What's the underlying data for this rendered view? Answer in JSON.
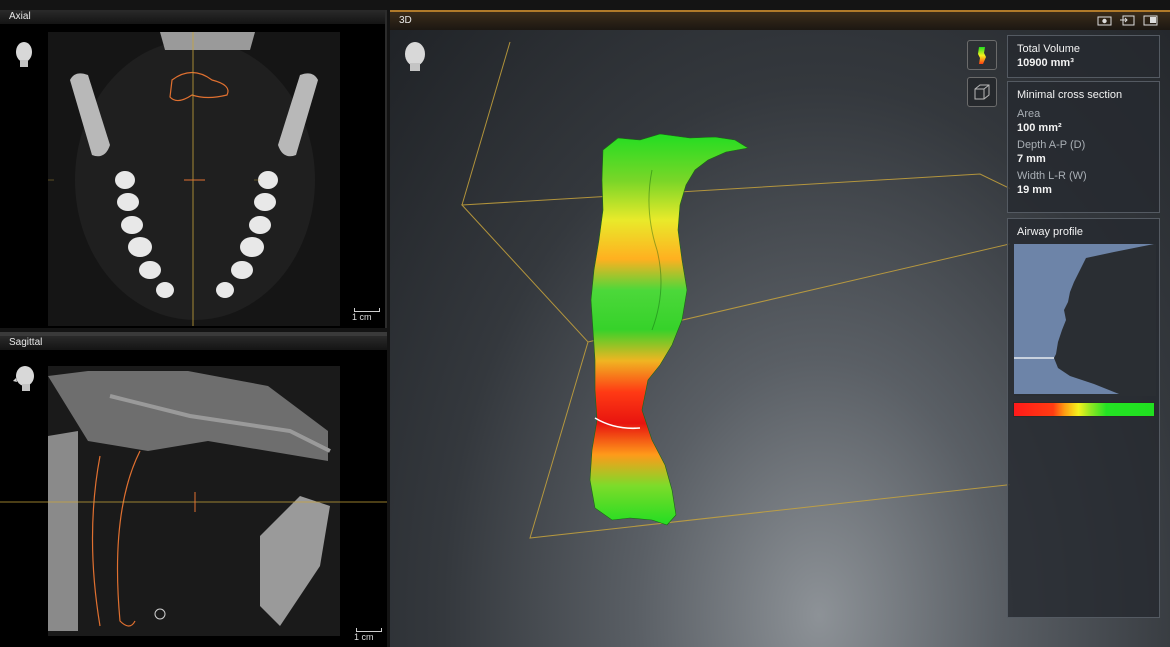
{
  "axial": {
    "title": "Axial",
    "scale_label": "1 cm",
    "head_icon": "head-front-icon"
  },
  "sagittal": {
    "title": "Sagittal",
    "scale_label": "1 cm",
    "head_icon": "head-side-icon"
  },
  "view3d": {
    "title": "3D",
    "top_icons": [
      "camera-icon",
      "export-icon",
      "maximize-icon"
    ],
    "tools": [
      "airway-colormap-icon",
      "bounding-box-icon"
    ],
    "head_icon": "head-front-icon"
  },
  "panel": {
    "total_volume": {
      "label": "Total Volume",
      "value": "10900 mm³"
    },
    "minimal_cross_section": {
      "title": "Minimal cross section",
      "area_label": "Area",
      "area_value": "100 mm²",
      "depth_label": "Depth A-P (D)",
      "depth_value": "7 mm",
      "width_label": "Width L-R (W)",
      "width_value": "19 mm"
    },
    "airway_profile": {
      "title": "Airway profile"
    }
  },
  "colors": {
    "frame_accent": "#b07a2a",
    "guide_line": "#c8a43c",
    "airway_outline": "#e07030",
    "scale_low": "#ff1a1a",
    "scale_mid": "#f6f21c",
    "scale_high": "#20e020",
    "profile_fill": "#6d84a8"
  }
}
